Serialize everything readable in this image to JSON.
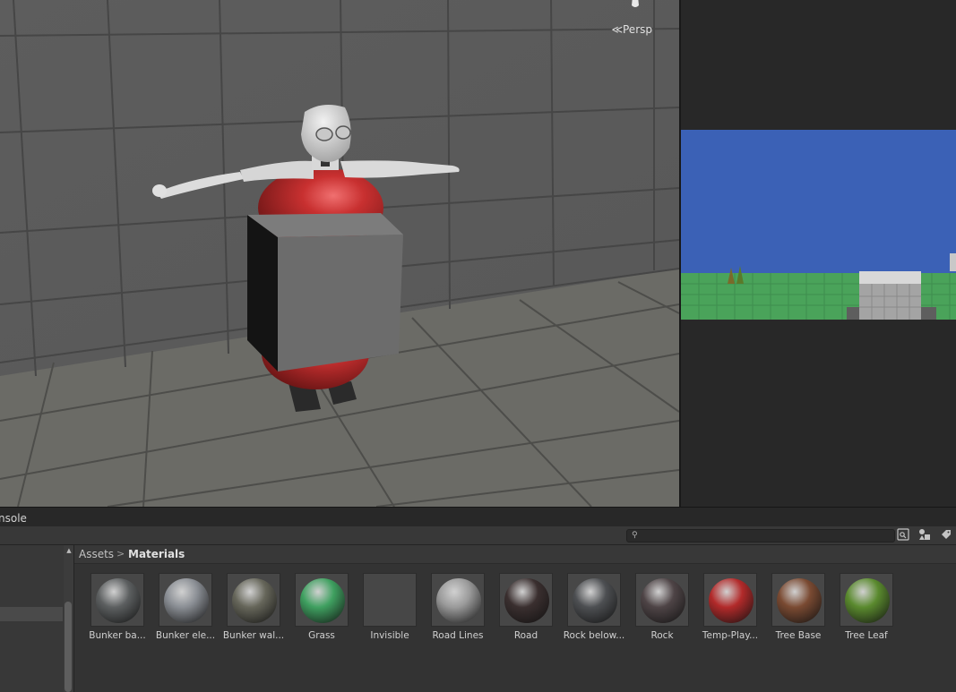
{
  "scene_view": {
    "projection_label": "Persp",
    "projection_icon": "perspective-chevron-icon"
  },
  "game_view": {
    "colors": {
      "sky": "#3b61b6",
      "grass": "#4aa35a"
    }
  },
  "bottom_panel": {
    "tab_label": "nsole",
    "search": {
      "value": "",
      "icon": "search-icon"
    },
    "toolbar_icons": [
      "search-by-type-icon",
      "filter-by-label-icon",
      "tag-icon"
    ]
  },
  "breadcrumb": {
    "root": "Assets",
    "separator": ">",
    "current": "Materials"
  },
  "materials": [
    {
      "label": "Bunker ba...",
      "color": "#5c5f60"
    },
    {
      "label": "Bunker ele...",
      "color": "#8a8e94"
    },
    {
      "label": "Bunker wal...",
      "color": "#66665a"
    },
    {
      "label": "Grass",
      "color": "#3fa060"
    },
    {
      "label": "Invisible",
      "color": "#474747"
    },
    {
      "label": "Road Lines",
      "color": "#9a9a9a"
    },
    {
      "label": "Road",
      "color": "#3a2f2f"
    },
    {
      "label": "Rock below...",
      "color": "#4d4f52"
    },
    {
      "label": "Rock",
      "color": "#4e4446"
    },
    {
      "label": "Temp-Play...",
      "color": "#b22a2a"
    },
    {
      "label": "Tree Base",
      "color": "#7a4a32"
    },
    {
      "label": "Tree Leaf",
      "color": "#5a8a2e"
    }
  ]
}
